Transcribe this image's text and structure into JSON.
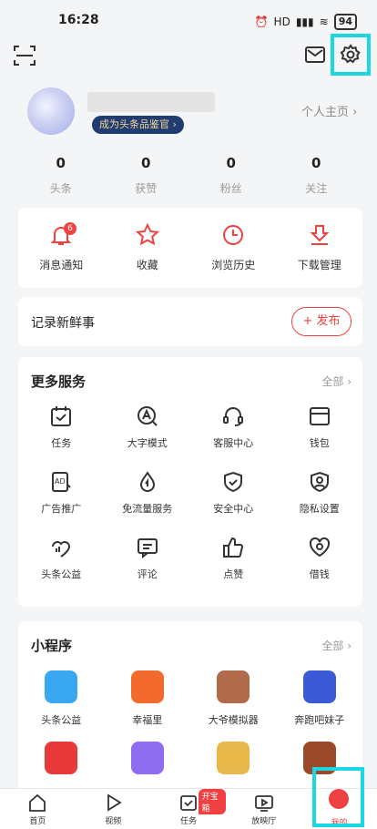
{
  "status": {
    "time": "16:28",
    "battery": "94",
    "signal": "HD"
  },
  "profile": {
    "badge": "成为头条品鉴官 ›",
    "home_link": "个人主页 ›"
  },
  "stats": [
    {
      "num": "0",
      "label": "头条"
    },
    {
      "num": "0",
      "label": "获赞"
    },
    {
      "num": "0",
      "label": "粉丝"
    },
    {
      "num": "0",
      "label": "关注"
    }
  ],
  "quick": [
    {
      "label": "消息通知",
      "icon": "bell-icon",
      "badge": "6"
    },
    {
      "label": "收藏",
      "icon": "star-icon"
    },
    {
      "label": "浏览历史",
      "icon": "clock-icon"
    },
    {
      "label": "下载管理",
      "icon": "download-icon"
    }
  ],
  "record": {
    "title": "记录新鲜事",
    "publish": "+ 发布"
  },
  "more": {
    "title": "更多服务",
    "all": "全部 ›",
    "items": [
      {
        "label": "任务",
        "icon": "task-calendar-icon"
      },
      {
        "label": "大字模式",
        "icon": "large-text-icon"
      },
      {
        "label": "客服中心",
        "icon": "headset-icon"
      },
      {
        "label": "钱包",
        "icon": "wallet-icon"
      },
      {
        "label": "广告推广",
        "icon": "ad-icon"
      },
      {
        "label": "免流量服务",
        "icon": "drop-icon"
      },
      {
        "label": "安全中心",
        "icon": "shield-icon"
      },
      {
        "label": "隐私设置",
        "icon": "privacy-icon"
      },
      {
        "label": "头条公益",
        "icon": "charity-icon"
      },
      {
        "label": "评论",
        "icon": "comment-icon"
      },
      {
        "label": "点赞",
        "icon": "thumbs-up-icon"
      },
      {
        "label": "借钱",
        "icon": "loan-icon"
      }
    ]
  },
  "mini": {
    "title": "小程序",
    "all": "全部 ›",
    "items": [
      {
        "label": "头条公益",
        "color": "#3aa8f0"
      },
      {
        "label": "幸福里",
        "color": "#f26a2e"
      },
      {
        "label": "大爷模拟器",
        "color": "#b06b4a"
      },
      {
        "label": "奔跑吧妹子",
        "color": "#3b5bd6"
      },
      {
        "label": "",
        "color": "#e83a3a"
      },
      {
        "label": "",
        "color": "#8f6df0"
      },
      {
        "label": "",
        "color": "#e9b84a"
      },
      {
        "label": "",
        "color": "#9a4a2a"
      }
    ]
  },
  "tabs": [
    {
      "label": "首页",
      "icon": "home-icon"
    },
    {
      "label": "视频",
      "icon": "play-icon"
    },
    {
      "label": "任务",
      "icon": "task-icon",
      "badge": "开宝箱"
    },
    {
      "label": "放映厅",
      "icon": "cinema-icon"
    },
    {
      "label": "我的",
      "icon": "me-icon"
    }
  ],
  "colors": {
    "accent": "#f04142",
    "highlight": "#1ad7e3"
  }
}
